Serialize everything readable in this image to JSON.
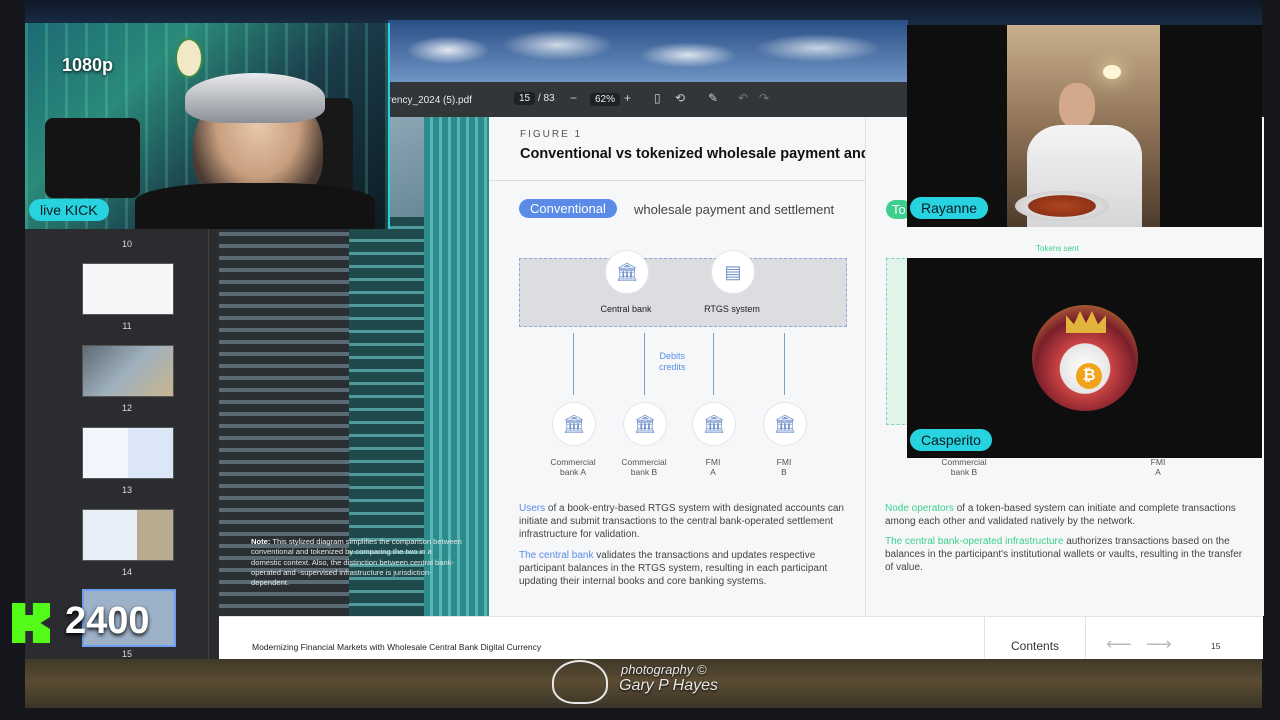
{
  "stream": {
    "resolution": "1080p",
    "live_tag": "live KICK",
    "viewer_count": "2400"
  },
  "participants": [
    {
      "name": "Rayanne"
    },
    {
      "name": "Casperito"
    }
  ],
  "pdf_toolbar": {
    "filename": "rency_2024 (5).pdf",
    "current_page": "15",
    "total_pages": "/ 83",
    "zoom": "62%"
  },
  "thumbnails": [
    "10",
    "11",
    "12",
    "13",
    "14",
    "15"
  ],
  "document": {
    "figure_label": "FIGURE 1",
    "figure_title": "Conventional vs tokenized wholesale payment and settl",
    "note_bold": "Note:",
    "note_text": " This stylized diagram simplifies the comparison between conventional and tokenized by comparing the two in a domestic context. Also, the distinction between central bank-operated and -supervised infrastructure is jurisdiction-dependent.",
    "conventional": {
      "pill": "Conventional",
      "pill_rest": "wholesale payment and settlement",
      "central_bank": "Central bank",
      "rtgs": "RTGS system",
      "debits": "Debits",
      "credits": "credits",
      "nodes": [
        {
          "line1": "Commercial",
          "line2": "bank A"
        },
        {
          "line1": "Commercial",
          "line2": "bank B"
        },
        {
          "line1": "FMI",
          "line2": "A"
        },
        {
          "line1": "FMI",
          "line2": "B"
        }
      ],
      "para1_hl": "Users",
      "para1": " of a book-entry-based RTGS system with designated accounts can initiate and submit transactions to the central bank-operated settlement infrastructure for validation.",
      "para2_hl": "The central bank",
      "para2": " validates the transactions and updates respective participant balances in the RTGS system, resulting in each participant updating their internal books and core banking systems."
    },
    "tokenized": {
      "pill": "To",
      "tokens_sent": "Tokens sent",
      "nodes": [
        {
          "line1": "Commercial",
          "line2": "bank B"
        },
        {
          "line1": "FMI",
          "line2": "A"
        }
      ],
      "para1_hl": "Node operators",
      "para1": " of a token-based system can initiate and complete transactions among each other and validated natively by the network.",
      "para2_hl": "The central bank-operated infrastructure",
      "para2": " authorizes transactions based on the balances in the participant's institutional wallets or vaults, resulting in the transfer of value."
    },
    "footer_title": "Modernizing Financial Markets with Wholesale Central Bank Digital Currency",
    "contents": "Contents",
    "page_number": "15"
  },
  "photo_credit": {
    "line1": "photography ©",
    "line2": "Gary P Hayes"
  },
  "colors": {
    "accent_blue": "#5a8be6",
    "accent_green": "#3ecf8e",
    "name_tag": "#26d3df",
    "kick_green": "#53fc18"
  }
}
